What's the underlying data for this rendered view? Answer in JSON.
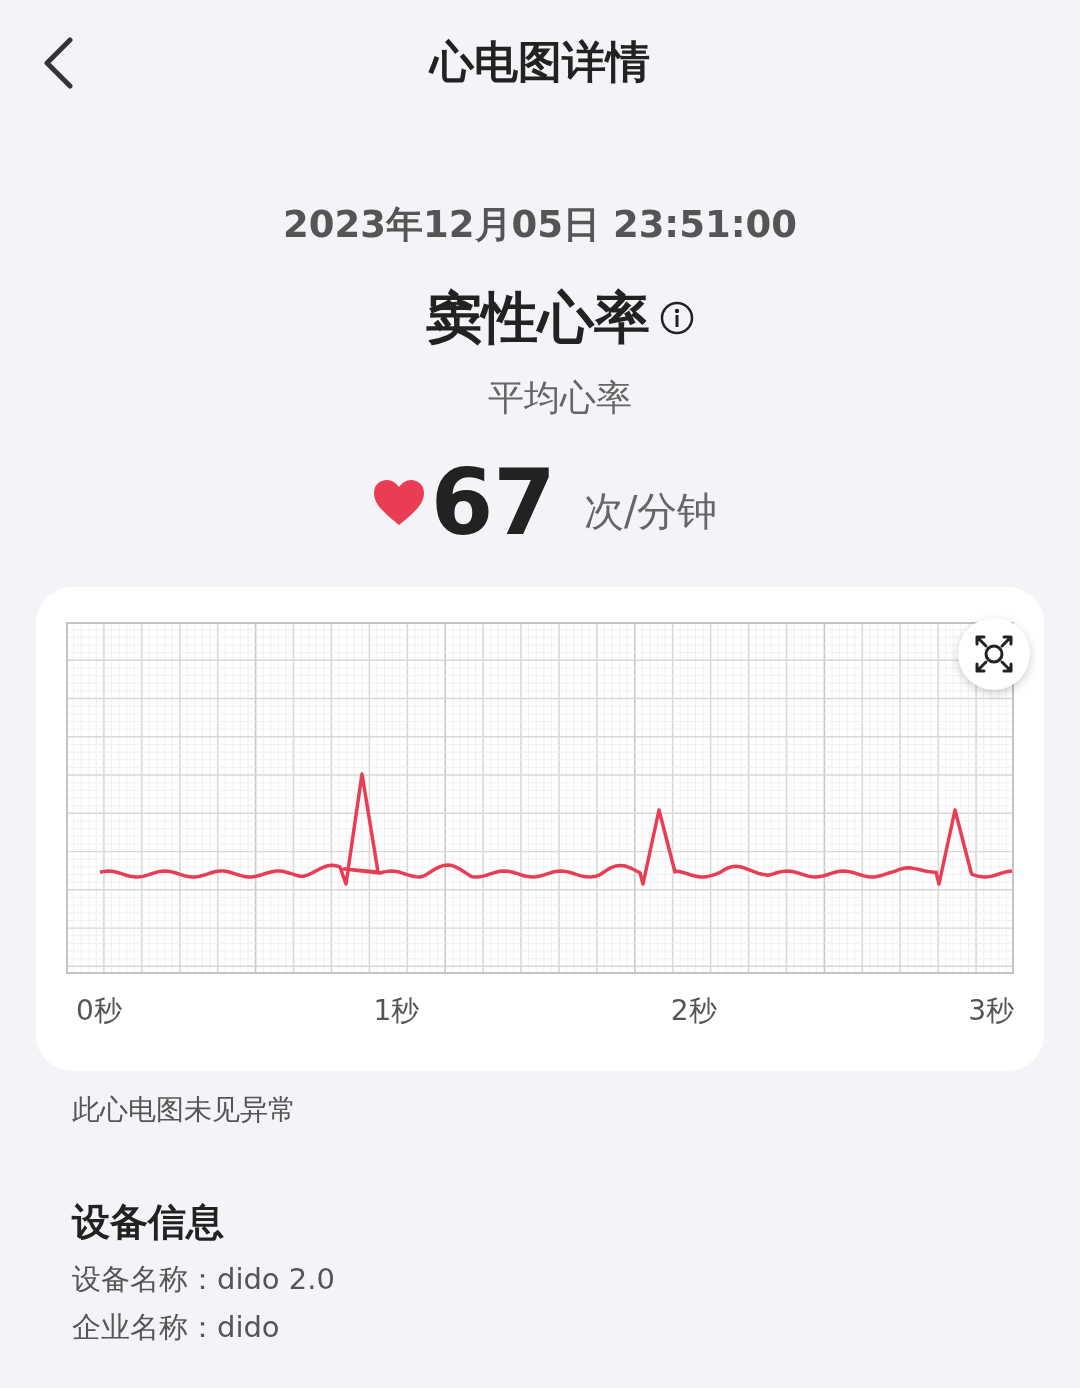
{
  "header": {
    "title": "心电图详情"
  },
  "summary": {
    "datetime": "2023年12月05日 23:51:00",
    "rhythm": "窦性心率",
    "average_label": "平均心率",
    "heart_rate": "67",
    "unit": "次/分钟"
  },
  "ecg": {
    "x_labels": [
      "0秒",
      "1秒",
      "2秒",
      "3秒"
    ]
  },
  "note": "此心电图未见异常",
  "device_info": {
    "title": "设备信息",
    "lines": [
      "设备名称：dido 2.0",
      "企业名称：dido"
    ]
  }
}
